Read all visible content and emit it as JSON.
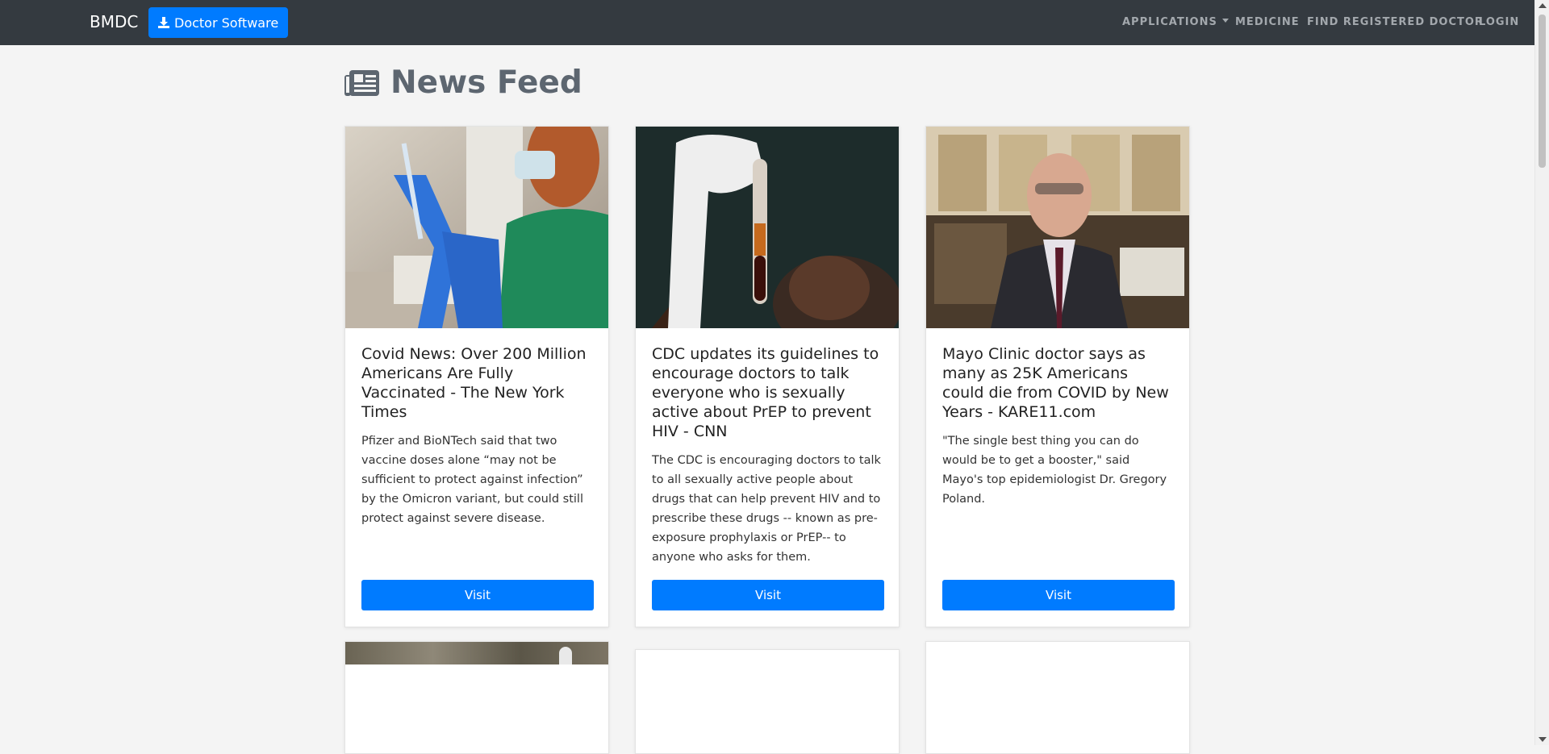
{
  "navbar": {
    "brand": "BMDC",
    "download_button": "Doctor Software",
    "links": {
      "applications": "APPLICATIONS",
      "medicine": "MEDICINE",
      "find_doctor": "FIND REGISTERED DOCTOR",
      "login": "LOGIN"
    }
  },
  "page": {
    "title": "News Feed"
  },
  "cards": [
    {
      "title": "Covid News: Over 200 Million Americans Are Fully Vaccinated - The New York Times",
      "text": "Pfizer and BioNTech said that two vaccine doses alone “may not be sufficient to protect against infection” by the Omicron variant, but could still protect against severe disease.",
      "button": "Visit"
    },
    {
      "title": "CDC updates its guidelines to encourage doctors to talk everyone who is sexually active about PrEP to prevent HIV - CNN",
      "text": "The CDC is encouraging doctors to talk to all sexually active people about drugs that can help prevent HIV and to prescribe these drugs -- known as pre-exposure prophylaxis or PrEP-- to anyone who asks for them.",
      "button": "Visit"
    },
    {
      "title": "Mayo Clinic doctor says as many as 25K Americans could die from COVID by New Years - KARE11.com",
      "text": "\"The single best thing you can do would be to get a booster,\" said Mayo's top epidemiologist Dr. Gregory Poland.",
      "button": "Visit"
    }
  ],
  "colors": {
    "navbar_bg": "#343a40",
    "primary": "#007bff",
    "page_bg": "#f4f4f4"
  }
}
